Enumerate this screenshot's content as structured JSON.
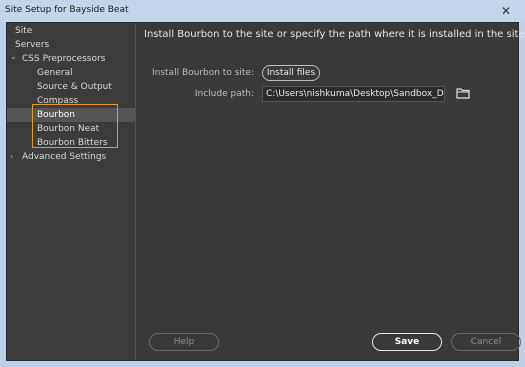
{
  "window": {
    "title": "Site Setup for Bayside Beat",
    "close_glyph": "✕"
  },
  "sidebar": {
    "items": [
      {
        "label": "Site",
        "level": 0
      },
      {
        "label": "Servers",
        "level": 0
      },
      {
        "label": "CSS Preprocessors",
        "level": 0,
        "expanded": true,
        "chevron": "⌄"
      },
      {
        "label": "General",
        "level": 1
      },
      {
        "label": "Source & Output",
        "level": 1
      },
      {
        "label": "Compass",
        "level": 1
      },
      {
        "label": "Bourbon",
        "level": 1,
        "selected": true
      },
      {
        "label": "Bourbon Neat",
        "level": 1
      },
      {
        "label": "Bourbon Bitters",
        "level": 1
      },
      {
        "label": "Advanced Settings",
        "level": 0,
        "expanded": false,
        "chevron": "›"
      }
    ]
  },
  "main": {
    "heading": "Install Bourbon to the site or specify the path where it is installed in the site",
    "install_label": "Install Bourbon to site:",
    "install_button": "Install files",
    "include_label": "Include path:",
    "include_path_value": "C:\\Users\\nishkuma\\Desktop\\Sandbox_DwModern-\\"
  },
  "footer": {
    "help": "Help",
    "save": "Save",
    "cancel": "Cancel"
  },
  "colors": {
    "highlight": "#e8952a",
    "panel_bg": "#3a3a3a",
    "selected_bg": "#555555",
    "folder_icon": "#e0e0e0"
  }
}
